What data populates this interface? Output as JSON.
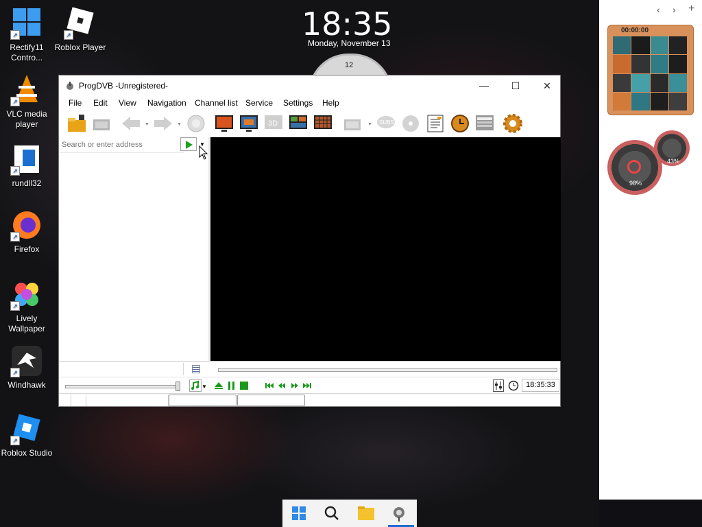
{
  "desktop": {
    "icons": [
      {
        "label": "Rectify11\nContro...",
        "icon": "rectify11-icon"
      },
      {
        "label": "Roblox Player",
        "icon": "roblox-player-icon"
      },
      {
        "label": "VLC media\nplayer",
        "icon": "vlc-icon"
      },
      {
        "label": "rundll32",
        "icon": "rundll32-icon"
      },
      {
        "label": "Firefox",
        "icon": "firefox-icon"
      },
      {
        "label": "Lively\nWallpaper",
        "icon": "lively-wallpaper-icon"
      },
      {
        "label": "Windhawk",
        "icon": "windhawk-icon"
      },
      {
        "label": "Roblox Studio",
        "icon": "roblox-studio-icon"
      }
    ],
    "clock": {
      "time": "18:35",
      "date": "Monday, November 13",
      "dial_label": "12"
    }
  },
  "widgets": {
    "puzzle_timer": "00:00:00",
    "gauge_large_value": "98%",
    "gauge_small_value": "43%"
  },
  "window": {
    "title": "ProgDVB -Unregistered-",
    "controls": {
      "minimize": "—",
      "maximize": "☐",
      "close": "✕"
    },
    "menu": [
      "File",
      "Edit",
      "View",
      "Navigation",
      "Channel list",
      "Service",
      "Settings",
      "Help"
    ],
    "toolbar_icons": [
      "open-folder-icon",
      "record-icon",
      "back-arrow-icon",
      "forward-arrow-icon",
      "globe-icon",
      "monitor-orange-icon",
      "monitor-blue-icon",
      "3d-icon",
      "mosaic-icon",
      "grid-tv-icon",
      "capture-icon",
      "subtitles-icon",
      "disc-icon",
      "epg-icon",
      "scheduler-clock-icon",
      "teletext-icon",
      "settings-gear-icon"
    ],
    "address": {
      "placeholder": "Search or enter address",
      "value": ""
    },
    "time_display": "18:35:33"
  },
  "colors": {
    "accent": "#1b6fd1",
    "play_green": "#1aa31a",
    "wallpaper": "#131316"
  }
}
